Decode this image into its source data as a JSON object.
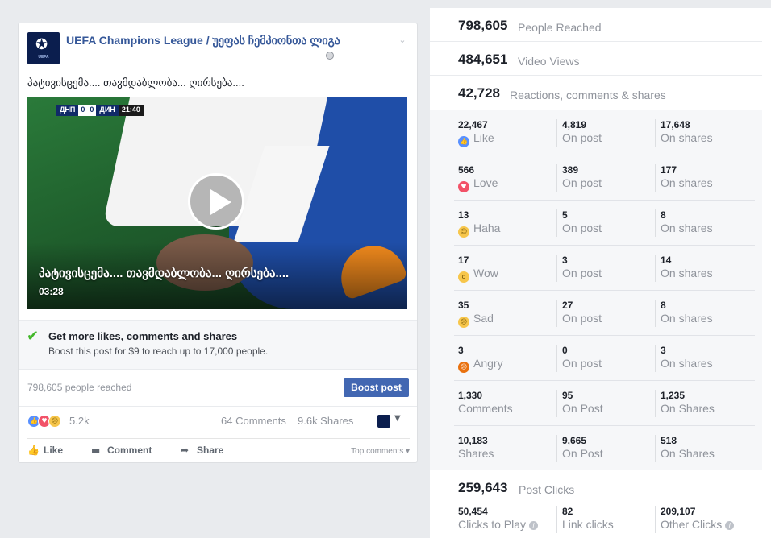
{
  "post": {
    "page_name": "UEFA Champions League / უეფას ჩემპიონთა ლიგა",
    "logo_text": "UEFA",
    "text": "პატივისცემა.... თავმდაბლობა... ღირსება....",
    "video": {
      "scoreboard": {
        "home": "ДНП",
        "home_score": "0",
        "away_score": "0",
        "away": "ДИН",
        "time": "21:40"
      },
      "caption": "პატივისცემა.... თავმდაბლობა... ღირსება....",
      "duration": "03:28"
    },
    "promo": {
      "title": "Get more likes, comments and shares",
      "subtitle": "Boost this post for $9 to reach up to 17,000 people."
    },
    "reach_text": "798,605 people reached",
    "boost_label": "Boost post",
    "reactions_count": "5.2k",
    "comments_count": "64 Comments",
    "shares_count": "9.6k Shares",
    "actions": {
      "like": "Like",
      "comment": "Comment",
      "share": "Share"
    },
    "top_comments": "Top comments ▾"
  },
  "insights": {
    "people_reached": {
      "value": "798,605",
      "label": "People Reached"
    },
    "video_views": {
      "value": "484,651",
      "label": "Video Views"
    },
    "reactions_total": {
      "value": "42,728",
      "label": "Reactions, comments & shares"
    },
    "breakdown": [
      {
        "icon": "like",
        "total": "22,467",
        "name": "Like",
        "on_post": "4,819",
        "on_post_label": "On post",
        "on_shares": "17,648",
        "on_shares_label": "On shares"
      },
      {
        "icon": "love",
        "total": "566",
        "name": "Love",
        "on_post": "389",
        "on_post_label": "On post",
        "on_shares": "177",
        "on_shares_label": "On shares"
      },
      {
        "icon": "haha",
        "total": "13",
        "name": "Haha",
        "on_post": "5",
        "on_post_label": "On post",
        "on_shares": "8",
        "on_shares_label": "On shares"
      },
      {
        "icon": "wow",
        "total": "17",
        "name": "Wow",
        "on_post": "3",
        "on_post_label": "On post",
        "on_shares": "14",
        "on_shares_label": "On shares"
      },
      {
        "icon": "sad",
        "total": "35",
        "name": "Sad",
        "on_post": "27",
        "on_post_label": "On post",
        "on_shares": "8",
        "on_shares_label": "On shares"
      },
      {
        "icon": "angry",
        "total": "3",
        "name": "Angry",
        "on_post": "0",
        "on_post_label": "On post",
        "on_shares": "3",
        "on_shares_label": "On shares"
      },
      {
        "icon": "",
        "total": "1,330",
        "name": "Comments",
        "on_post": "95",
        "on_post_label": "On Post",
        "on_shares": "1,235",
        "on_shares_label": "On Shares"
      },
      {
        "icon": "",
        "total": "10,183",
        "name": "Shares",
        "on_post": "9,665",
        "on_post_label": "On Post",
        "on_shares": "518",
        "on_shares_label": "On Shares"
      }
    ],
    "post_clicks": {
      "value": "259,643",
      "label": "Post Clicks",
      "clicks_to_play": "50,454",
      "clicks_to_play_label": "Clicks to Play",
      "link_clicks": "82",
      "link_clicks_label": "Link clicks",
      "other_clicks": "209,107",
      "other_clicks_label": "Other Clicks"
    }
  }
}
